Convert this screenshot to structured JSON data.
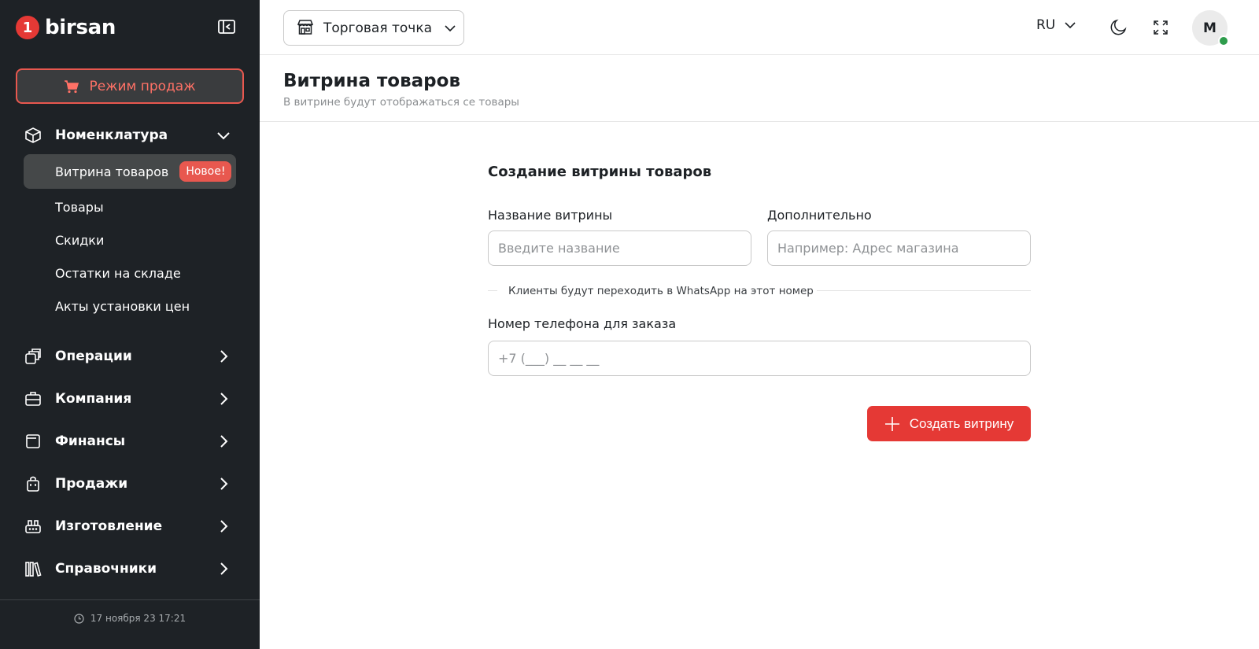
{
  "brand": {
    "name": "birsan",
    "mark": "1",
    "accent": "#e53935"
  },
  "sidebar": {
    "sales_mode_label": "Режим продаж",
    "groups": [
      {
        "icon": "box-icon",
        "label": "Номенклатура",
        "expanded": true
      },
      {
        "icon": "layers-icon",
        "label": "Операции"
      },
      {
        "icon": "briefcase-icon",
        "label": "Компания"
      },
      {
        "icon": "wallet-icon",
        "label": "Финансы"
      },
      {
        "icon": "bag-icon",
        "label": "Продажи"
      },
      {
        "icon": "factory-icon",
        "label": "Изготовление"
      },
      {
        "icon": "books-icon",
        "label": "Справочники"
      }
    ],
    "sub_items": [
      {
        "label": "Витрина товаров",
        "badge": "Новое!",
        "active": true
      },
      {
        "label": "Товары"
      },
      {
        "label": "Скидки"
      },
      {
        "label": "Остатки на складе"
      },
      {
        "label": "Акты установки цен"
      }
    ],
    "footer_datetime": "17 ноября 23 17:21"
  },
  "topbar": {
    "store_select": "Торговая точка",
    "language": "RU",
    "avatar_initial": "M",
    "status_color": "#2e9c4c"
  },
  "page": {
    "title": "Витрина товаров",
    "subtitle": "В витрине будут отображаться се товары"
  },
  "form": {
    "title": "Создание витрины товаров",
    "name_label": "Название витрины",
    "name_placeholder": "Введите название",
    "extra_label": "Дополнительно",
    "extra_placeholder": "Например: Адрес магазина",
    "divider_text": "Клиенты будут переходить в WhatsApp на этот номер",
    "phone_label": "Номер телефона для заказа",
    "phone_placeholder": "+7 (___) __ __ __",
    "submit_label": "Создать витрину"
  }
}
